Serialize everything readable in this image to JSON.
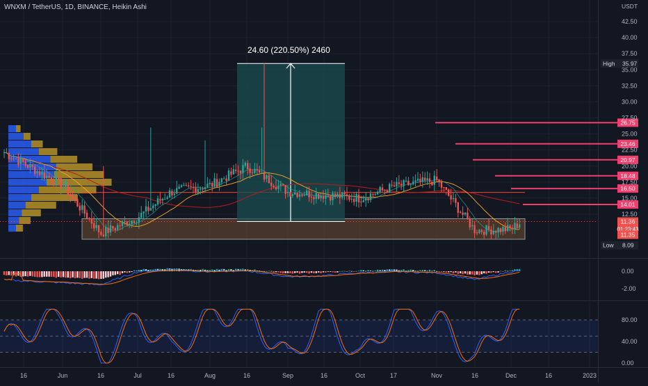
{
  "header": {
    "symbol_line": "WNXM / TetherUS, 1D, BINANCE, Heikin Ashi"
  },
  "colors": {
    "background": "#131722",
    "up": "#26a69a",
    "down": "#ef5350",
    "level_line": "#f23f6e",
    "resistance": "#f44336",
    "measure_fill": "#1b4e4f",
    "profile_blue": "#2962ff",
    "profile_gold": "#c9a227",
    "macd": "#2962ff",
    "signal": "#ff6d00",
    "stoch_k": "#2962ff",
    "stoch_d": "#ff6d00"
  },
  "measure": {
    "label": "24.60 (220.50%) 2460"
  },
  "price_axis": {
    "currency": "USDT",
    "ticks": [
      "42.50",
      "40.00",
      "37.50",
      "35.00",
      "32.50",
      "30.00",
      "27.50",
      "25.00",
      "22.50",
      "20.00",
      "17.50",
      "15.00",
      "12.50"
    ],
    "high_label": "High",
    "high_value": "35.97",
    "low_label": "Low",
    "low_value": "8.09",
    "current_price": "11.36",
    "countdown": "01:23:43",
    "box_price": "11.35"
  },
  "levels": [
    "26.75",
    "23.46",
    "20.97",
    "18.48",
    "16.50",
    "14.01"
  ],
  "macd_axis": {
    "ticks": [
      "0.00",
      "-2.00"
    ]
  },
  "stoch_axis": {
    "ticks": [
      "80.00",
      "40.00",
      "0.00"
    ]
  },
  "time_axis": {
    "labels": [
      "16",
      "Jun",
      "16",
      "Jul",
      "16",
      "Aug",
      "16",
      "Sep",
      "16",
      "Oct",
      "17",
      "Nov",
      "16",
      "Dec",
      "16",
      "2023"
    ]
  },
  "chart_data": [
    {
      "type": "candlestick",
      "title": "WNXM / TetherUS, 1D, BINANCE, Heikin Ashi",
      "ylabel": "USDT",
      "ylim": [
        8,
        45
      ],
      "x": [
        "May 16",
        "Jun 1",
        "Jun 16",
        "Jul 1",
        "Jul 16",
        "Aug 1",
        "Aug 16",
        "Sep 1",
        "Sep 16",
        "Oct 1",
        "Oct 17",
        "Nov 1",
        "Nov 16",
        "Dec 1",
        "Dec 6"
      ],
      "close": [
        22.5,
        17.0,
        9.5,
        12.0,
        16.0,
        17.0,
        20.0,
        16.0,
        15.5,
        15.0,
        16.8,
        17.8,
        10.0,
        10.2,
        11.36
      ],
      "annotations": [
        "24.60 (220.50%) 2460",
        "High 35.97",
        "Low 8.09"
      ],
      "horizontal_levels": [
        26.75,
        23.46,
        20.97,
        18.48,
        16.5,
        14.01
      ]
    },
    {
      "type": "bar",
      "title": "MACD histogram",
      "ylim": [
        -3,
        1.5
      ],
      "x": [
        "May 16",
        "Jun 1",
        "Jun 16",
        "Jul 1",
        "Jul 16",
        "Aug 1",
        "Aug 16",
        "Sep 1",
        "Sep 16",
        "Oct 1",
        "Oct 17",
        "Nov 1",
        "Nov 16",
        "Dec 1",
        "Dec 6"
      ],
      "values": [
        -0.6,
        -0.9,
        -1.1,
        0.2,
        0.4,
        0.2,
        0.3,
        -0.3,
        -0.2,
        0.1,
        0.2,
        0.1,
        -0.6,
        0.2,
        0.3
      ]
    },
    {
      "type": "line",
      "title": "Stochastic RSI",
      "ylim": [
        0,
        100
      ],
      "x": [
        "May 16",
        "Jun 1",
        "Jun 16",
        "Jul 1",
        "Jul 16",
        "Aug 1",
        "Aug 16",
        "Sep 1",
        "Sep 16",
        "Oct 1",
        "Oct 17",
        "Nov 1",
        "Nov 16",
        "Dec 1",
        "Dec 6"
      ],
      "series": [
        {
          "values": [
            40,
            90,
            10,
            85,
            20,
            90,
            95,
            5,
            95,
            5,
            95,
            80,
            5,
            95,
            90
          ]
        }
      ]
    }
  ]
}
